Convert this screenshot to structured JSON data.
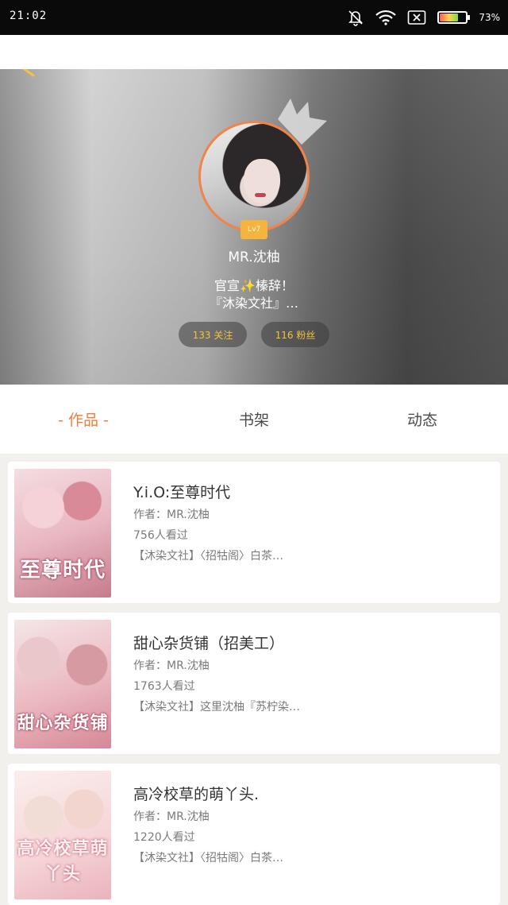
{
  "status_bar": {
    "time": "21:02",
    "battery_text": "73%",
    "battery_level": 0.73,
    "icons": [
      "mute-bell-icon",
      "wifi-icon",
      "sim-off-icon",
      "battery-icon"
    ]
  },
  "profile": {
    "username": "MR.沈柚",
    "level": "Lv7",
    "bio_line1_a": "官宣",
    "bio_line1_sparkle": "✨",
    "bio_line1_b": "榛辞！",
    "bio_line2": "『沐染文社』…",
    "following": "133 关注",
    "fans": "116 粉丝",
    "accent": "#f0844a"
  },
  "tabs": [
    {
      "label": "- 作品 -",
      "active": true
    },
    {
      "label": "书架",
      "active": false
    },
    {
      "label": "动态",
      "active": false
    }
  ],
  "books": [
    {
      "title": "Y.i.O:至尊时代",
      "author": "作者：MR.沈柚",
      "views": "756人看过",
      "desc": "【沐染文社】〈招牯阁〉白茶…",
      "cover_text": "至尊时代"
    },
    {
      "title": "甜心杂货铺（招美工）",
      "author": "作者：MR.沈柚",
      "views": "1763人看过",
      "desc": "【沐染文社】这里沈柚『苏柠染…",
      "cover_text": "甜心杂货铺"
    },
    {
      "title": "高冷校草的萌丫头.",
      "author": "作者：MR.沈柚",
      "views": "1220人看过",
      "desc": "【沐染文社】〈招牯阁〉白茶…",
      "cover_text": "高冷校草萌丫头"
    }
  ]
}
